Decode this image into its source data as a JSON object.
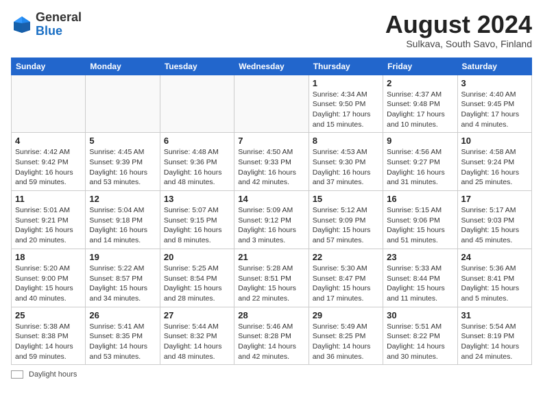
{
  "header": {
    "logo_general": "General",
    "logo_blue": "Blue",
    "month_title": "August 2024",
    "subtitle": "Sulkava, South Savo, Finland"
  },
  "days_of_week": [
    "Sunday",
    "Monday",
    "Tuesday",
    "Wednesday",
    "Thursday",
    "Friday",
    "Saturday"
  ],
  "weeks": [
    [
      {
        "day": "",
        "info": ""
      },
      {
        "day": "",
        "info": ""
      },
      {
        "day": "",
        "info": ""
      },
      {
        "day": "",
        "info": ""
      },
      {
        "day": "1",
        "info": "Sunrise: 4:34 AM\nSunset: 9:50 PM\nDaylight: 17 hours\nand 15 minutes."
      },
      {
        "day": "2",
        "info": "Sunrise: 4:37 AM\nSunset: 9:48 PM\nDaylight: 17 hours\nand 10 minutes."
      },
      {
        "day": "3",
        "info": "Sunrise: 4:40 AM\nSunset: 9:45 PM\nDaylight: 17 hours\nand 4 minutes."
      }
    ],
    [
      {
        "day": "4",
        "info": "Sunrise: 4:42 AM\nSunset: 9:42 PM\nDaylight: 16 hours\nand 59 minutes."
      },
      {
        "day": "5",
        "info": "Sunrise: 4:45 AM\nSunset: 9:39 PM\nDaylight: 16 hours\nand 53 minutes."
      },
      {
        "day": "6",
        "info": "Sunrise: 4:48 AM\nSunset: 9:36 PM\nDaylight: 16 hours\nand 48 minutes."
      },
      {
        "day": "7",
        "info": "Sunrise: 4:50 AM\nSunset: 9:33 PM\nDaylight: 16 hours\nand 42 minutes."
      },
      {
        "day": "8",
        "info": "Sunrise: 4:53 AM\nSunset: 9:30 PM\nDaylight: 16 hours\nand 37 minutes."
      },
      {
        "day": "9",
        "info": "Sunrise: 4:56 AM\nSunset: 9:27 PM\nDaylight: 16 hours\nand 31 minutes."
      },
      {
        "day": "10",
        "info": "Sunrise: 4:58 AM\nSunset: 9:24 PM\nDaylight: 16 hours\nand 25 minutes."
      }
    ],
    [
      {
        "day": "11",
        "info": "Sunrise: 5:01 AM\nSunset: 9:21 PM\nDaylight: 16 hours\nand 20 minutes."
      },
      {
        "day": "12",
        "info": "Sunrise: 5:04 AM\nSunset: 9:18 PM\nDaylight: 16 hours\nand 14 minutes."
      },
      {
        "day": "13",
        "info": "Sunrise: 5:07 AM\nSunset: 9:15 PM\nDaylight: 16 hours\nand 8 minutes."
      },
      {
        "day": "14",
        "info": "Sunrise: 5:09 AM\nSunset: 9:12 PM\nDaylight: 16 hours\nand 3 minutes."
      },
      {
        "day": "15",
        "info": "Sunrise: 5:12 AM\nSunset: 9:09 PM\nDaylight: 15 hours\nand 57 minutes."
      },
      {
        "day": "16",
        "info": "Sunrise: 5:15 AM\nSunset: 9:06 PM\nDaylight: 15 hours\nand 51 minutes."
      },
      {
        "day": "17",
        "info": "Sunrise: 5:17 AM\nSunset: 9:03 PM\nDaylight: 15 hours\nand 45 minutes."
      }
    ],
    [
      {
        "day": "18",
        "info": "Sunrise: 5:20 AM\nSunset: 9:00 PM\nDaylight: 15 hours\nand 40 minutes."
      },
      {
        "day": "19",
        "info": "Sunrise: 5:22 AM\nSunset: 8:57 PM\nDaylight: 15 hours\nand 34 minutes."
      },
      {
        "day": "20",
        "info": "Sunrise: 5:25 AM\nSunset: 8:54 PM\nDaylight: 15 hours\nand 28 minutes."
      },
      {
        "day": "21",
        "info": "Sunrise: 5:28 AM\nSunset: 8:51 PM\nDaylight: 15 hours\nand 22 minutes."
      },
      {
        "day": "22",
        "info": "Sunrise: 5:30 AM\nSunset: 8:47 PM\nDaylight: 15 hours\nand 17 minutes."
      },
      {
        "day": "23",
        "info": "Sunrise: 5:33 AM\nSunset: 8:44 PM\nDaylight: 15 hours\nand 11 minutes."
      },
      {
        "day": "24",
        "info": "Sunrise: 5:36 AM\nSunset: 8:41 PM\nDaylight: 15 hours\nand 5 minutes."
      }
    ],
    [
      {
        "day": "25",
        "info": "Sunrise: 5:38 AM\nSunset: 8:38 PM\nDaylight: 14 hours\nand 59 minutes."
      },
      {
        "day": "26",
        "info": "Sunrise: 5:41 AM\nSunset: 8:35 PM\nDaylight: 14 hours\nand 53 minutes."
      },
      {
        "day": "27",
        "info": "Sunrise: 5:44 AM\nSunset: 8:32 PM\nDaylight: 14 hours\nand 48 minutes."
      },
      {
        "day": "28",
        "info": "Sunrise: 5:46 AM\nSunset: 8:28 PM\nDaylight: 14 hours\nand 42 minutes."
      },
      {
        "day": "29",
        "info": "Sunrise: 5:49 AM\nSunset: 8:25 PM\nDaylight: 14 hours\nand 36 minutes."
      },
      {
        "day": "30",
        "info": "Sunrise: 5:51 AM\nSunset: 8:22 PM\nDaylight: 14 hours\nand 30 minutes."
      },
      {
        "day": "31",
        "info": "Sunrise: 5:54 AM\nSunset: 8:19 PM\nDaylight: 14 hours\nand 24 minutes."
      }
    ]
  ],
  "footer": {
    "legend_label": "Daylight hours"
  }
}
